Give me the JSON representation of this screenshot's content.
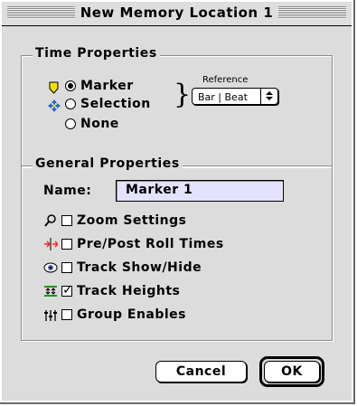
{
  "window": {
    "title": "New Memory Location 1"
  },
  "time_properties": {
    "title": "Time Properties",
    "options": [
      {
        "label": "Marker",
        "selected": true,
        "icon": "marker-icon"
      },
      {
        "label": "Selection",
        "selected": false,
        "icon": "selection-icon"
      },
      {
        "label": "None",
        "selected": false
      }
    ],
    "reference": {
      "label": "Reference",
      "value": "Bar | Beat"
    }
  },
  "general_properties": {
    "title": "General Properties",
    "name_label": "Name:",
    "name_value": "Marker 1",
    "checkboxes": [
      {
        "label": "Zoom Settings",
        "checked": false,
        "icon": "magnifier-icon"
      },
      {
        "label": "Pre/Post Roll Times",
        "checked": false,
        "icon": "preroll-icon"
      },
      {
        "label": "Track Show/Hide",
        "checked": false,
        "icon": "eye-icon"
      },
      {
        "label": "Track Heights",
        "checked": true,
        "icon": "track-heights-icon"
      },
      {
        "label": "Group Enables",
        "checked": false,
        "icon": "group-icon"
      }
    ]
  },
  "buttons": {
    "cancel": "Cancel",
    "ok": "OK"
  },
  "colors": {
    "dialog_bg": "#dcdcdc",
    "name_field_bg": "#e4e2ff",
    "marker_icon": "#f4e000",
    "selection_icon": "#2060e0",
    "preroll_icon": "#ff2020",
    "track_heights_icon": "#00a000"
  }
}
